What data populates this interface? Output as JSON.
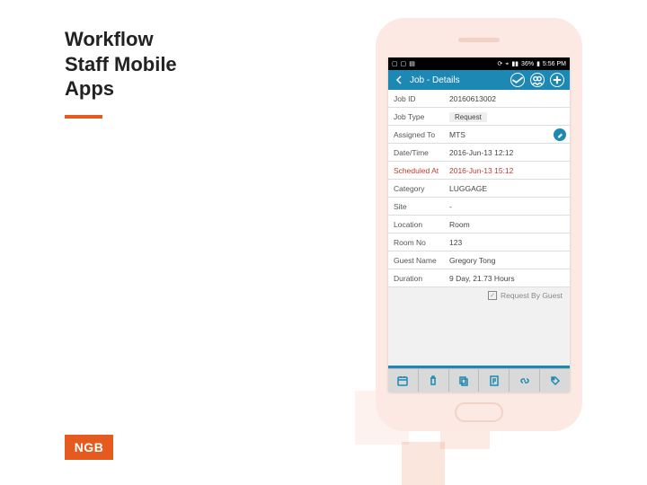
{
  "title_line1": "Workflow",
  "title_line2": "Staff Mobile",
  "title_line3": "Apps",
  "logo_text": "NGB",
  "status_bar": {
    "battery": "36%",
    "time": "5:56 PM"
  },
  "app_bar": {
    "title": "Job - Details"
  },
  "details": {
    "job_id_label": "Job ID",
    "job_id_value": "20160613002",
    "job_type_label": "Job Type",
    "job_type_value": "Request",
    "assigned_to_label": "Assigned To",
    "assigned_to_value": "MTS",
    "datetime_label": "Date/Time",
    "datetime_value": "2016-Jun-13 12:12",
    "scheduled_label": "Scheduled At",
    "scheduled_value": "2016-Jun-13 15:12",
    "category_label": "Category",
    "category_value": "LUGGAGE",
    "site_label": "Site",
    "site_value": "-",
    "location_label": "Location",
    "location_value": "Room",
    "roomno_label": "Room No",
    "roomno_value": "123",
    "guest_label": "Guest Name",
    "guest_value": "Gregory Tong",
    "duration_label": "Duration",
    "duration_value": "9 Day, 21.73 Hours",
    "request_by_guest": "Request By Guest"
  }
}
